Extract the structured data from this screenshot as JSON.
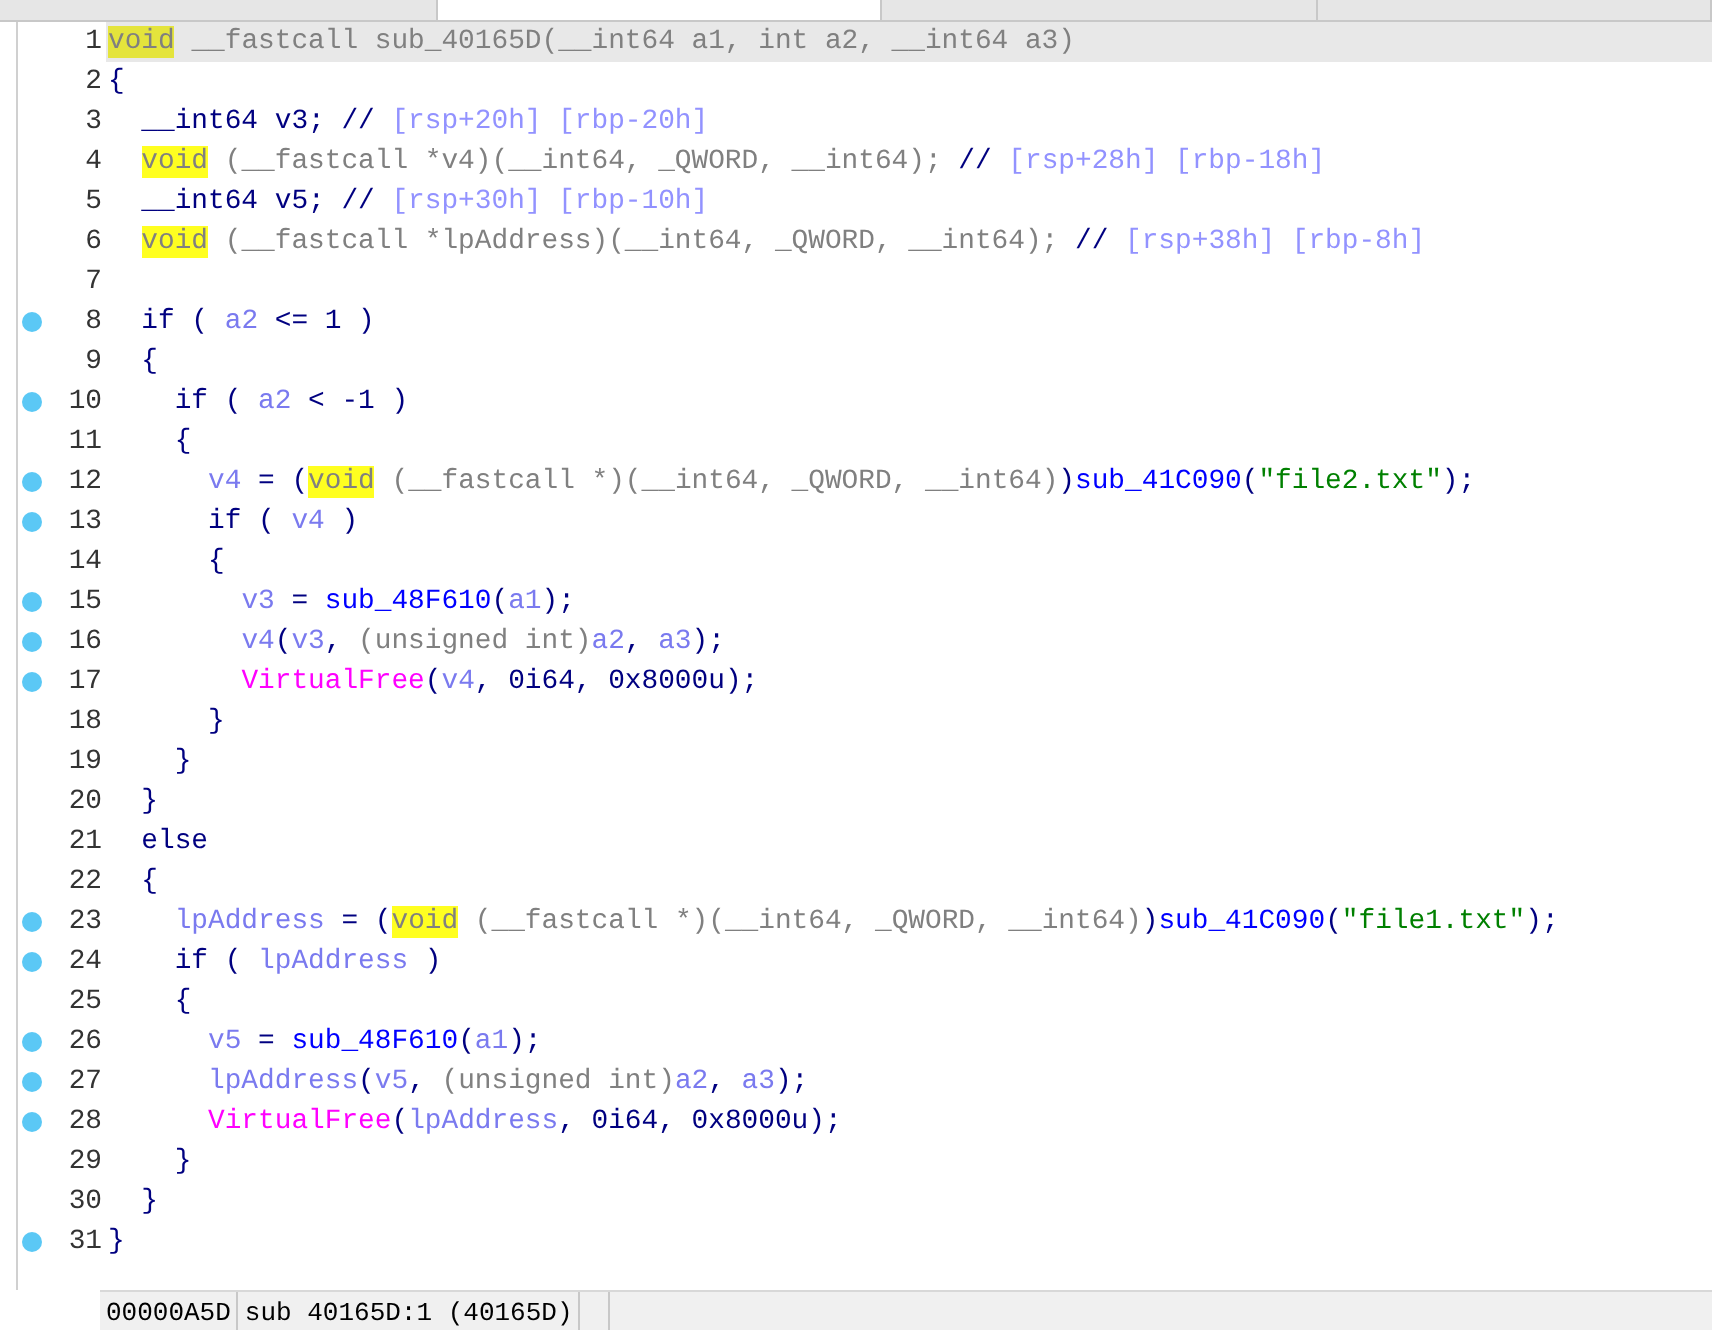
{
  "tabs": [
    {
      "selected": false
    },
    {
      "selected": true
    },
    {
      "selected": false
    },
    {
      "selected": false
    }
  ],
  "code_lines": [
    {
      "number": "1",
      "breakpoint": false,
      "current": true,
      "tokens": [
        {
          "kind": "h",
          "text": "void"
        },
        {
          "kind": "d",
          "text": " __fastcall sub_40165D(__int64 a1, int a2, __int64 a3)"
        }
      ]
    },
    {
      "number": "2",
      "breakpoint": false,
      "current": false,
      "tokens": [
        {
          "kind": "k",
          "text": "{"
        }
      ]
    },
    {
      "number": "3",
      "breakpoint": false,
      "current": false,
      "tokens": [
        {
          "kind": "k",
          "text": "  __int64 v3; // "
        },
        {
          "kind": "c",
          "text": "[rsp+20h] [rbp-20h]"
        }
      ]
    },
    {
      "number": "4",
      "breakpoint": false,
      "current": false,
      "tokens": [
        {
          "kind": "h",
          "text": "  void"
        },
        {
          "kind": "d",
          "text": " (__fastcall *v4)(__int64, _QWORD, __int64);"
        },
        {
          "kind": "k",
          "text": " // "
        },
        {
          "kind": "c",
          "text": "[rsp+28h] [rbp-18h]"
        }
      ]
    },
    {
      "number": "5",
      "breakpoint": false,
      "current": false,
      "tokens": [
        {
          "kind": "k",
          "text": "  __int64 v5; // "
        },
        {
          "kind": "c",
          "text": "[rsp+30h] [rbp-10h]"
        }
      ]
    },
    {
      "number": "6",
      "breakpoint": false,
      "current": false,
      "tokens": [
        {
          "kind": "h",
          "text": "  void"
        },
        {
          "kind": "d",
          "text": " (__fastcall *lpAddress)(__int64, _QWORD, __int64);"
        },
        {
          "kind": "k",
          "text": " // "
        },
        {
          "kind": "c",
          "text": "[rsp+38h] [rbp-8h]"
        }
      ]
    },
    {
      "number": "7",
      "breakpoint": false,
      "current": false
    },
    {
      "number": "8",
      "breakpoint": true,
      "current": false,
      "tokens": [
        {
          "kind": "k",
          "text": "  if ( "
        },
        {
          "kind": "v",
          "text": "a2"
        },
        {
          "kind": "k",
          "text": " <= 1 )"
        }
      ]
    },
    {
      "number": "9",
      "breakpoint": false,
      "current": false,
      "tokens": [
        {
          "kind": "k",
          "text": "  {"
        }
      ]
    },
    {
      "number": "10",
      "breakpoint": true,
      "current": false,
      "tokens": [
        {
          "kind": "k",
          "text": "    if ( "
        },
        {
          "kind": "v",
          "text": "a2"
        },
        {
          "kind": "k",
          "text": " < -1 )"
        }
      ]
    },
    {
      "number": "11",
      "breakpoint": false,
      "current": false,
      "tokens": [
        {
          "kind": "k",
          "text": "    {"
        }
      ]
    },
    {
      "number": "12",
      "breakpoint": true,
      "current": false,
      "tokens": [
        {
          "kind": "v",
          "text": "      v4"
        },
        {
          "kind": "k",
          "text": " = ("
        },
        {
          "kind": "h",
          "text": "void"
        },
        {
          "kind": "d",
          "text": " (__fastcall *)(__int64, _QWORD, __int64)"
        },
        {
          "kind": "k",
          "text": ")"
        },
        {
          "kind": "f",
          "text": "sub_41C090"
        },
        {
          "kind": "k",
          "text": "("
        },
        {
          "kind": "s",
          "text": "\"file2.txt\""
        },
        {
          "kind": "k",
          "text": ");"
        }
      ]
    },
    {
      "number": "13",
      "breakpoint": true,
      "current": false,
      "tokens": [
        {
          "kind": "k",
          "text": "      if ( "
        },
        {
          "kind": "v",
          "text": "v4"
        },
        {
          "kind": "k",
          "text": " )"
        }
      ]
    },
    {
      "number": "14",
      "breakpoint": false,
      "current": false,
      "tokens": [
        {
          "kind": "k",
          "text": "      {"
        }
      ]
    },
    {
      "number": "15",
      "breakpoint": true,
      "current": false,
      "tokens": [
        {
          "kind": "v",
          "text": "        v3"
        },
        {
          "kind": "k",
          "text": " = "
        },
        {
          "kind": "f",
          "text": "sub_48F610"
        },
        {
          "kind": "k",
          "text": "("
        },
        {
          "kind": "v",
          "text": "a1"
        },
        {
          "kind": "k",
          "text": ");"
        }
      ]
    },
    {
      "number": "16",
      "breakpoint": true,
      "current": false,
      "tokens": [
        {
          "kind": "v",
          "text": "        v4"
        },
        {
          "kind": "k",
          "text": "("
        },
        {
          "kind": "v",
          "text": "v3"
        },
        {
          "kind": "k",
          "text": ", "
        },
        {
          "kind": "d",
          "text": "(unsigned int)"
        },
        {
          "kind": "v",
          "text": "a2"
        },
        {
          "kind": "k",
          "text": ", "
        },
        {
          "kind": "v",
          "text": "a3"
        },
        {
          "kind": "k",
          "text": ");"
        }
      ]
    },
    {
      "number": "17",
      "breakpoint": true,
      "current": false,
      "tokens": [
        {
          "kind": "a",
          "text": "        VirtualFree"
        },
        {
          "kind": "k",
          "text": "("
        },
        {
          "kind": "v",
          "text": "v4"
        },
        {
          "kind": "k",
          "text": ", 0i64, 0x8000u);"
        }
      ]
    },
    {
      "number": "18",
      "breakpoint": false,
      "current": false,
      "tokens": [
        {
          "kind": "k",
          "text": "      }"
        }
      ]
    },
    {
      "number": "19",
      "breakpoint": false,
      "current": false,
      "tokens": [
        {
          "kind": "k",
          "text": "    }"
        }
      ]
    },
    {
      "number": "20",
      "breakpoint": false,
      "current": false,
      "tokens": [
        {
          "kind": "k",
          "text": "  }"
        }
      ]
    },
    {
      "number": "21",
      "breakpoint": false,
      "current": false,
      "tokens": [
        {
          "kind": "k",
          "text": "  else"
        }
      ]
    },
    {
      "number": "22",
      "breakpoint": false,
      "current": false,
      "tokens": [
        {
          "kind": "k",
          "text": "  {"
        }
      ]
    },
    {
      "number": "23",
      "breakpoint": true,
      "current": false,
      "tokens": [
        {
          "kind": "v",
          "text": "    lpAddress"
        },
        {
          "kind": "k",
          "text": " = ("
        },
        {
          "kind": "h",
          "text": "void"
        },
        {
          "kind": "d",
          "text": " (__fastcall *)(__int64, _QWORD, __int64)"
        },
        {
          "kind": "k",
          "text": ")"
        },
        {
          "kind": "f",
          "text": "sub_41C090"
        },
        {
          "kind": "k",
          "text": "("
        },
        {
          "kind": "s",
          "text": "\"file1.txt\""
        },
        {
          "kind": "k",
          "text": ");"
        }
      ]
    },
    {
      "number": "24",
      "breakpoint": true,
      "current": false,
      "tokens": [
        {
          "kind": "k",
          "text": "    if ( "
        },
        {
          "kind": "v",
          "text": "lpAddress"
        },
        {
          "kind": "k",
          "text": " )"
        }
      ]
    },
    {
      "number": "25",
      "breakpoint": false,
      "current": false,
      "tokens": [
        {
          "kind": "k",
          "text": "    {"
        }
      ]
    },
    {
      "number": "26",
      "breakpoint": true,
      "current": false,
      "tokens": [
        {
          "kind": "v",
          "text": "      v5"
        },
        {
          "kind": "k",
          "text": " = "
        },
        {
          "kind": "f",
          "text": "sub_48F610"
        },
        {
          "kind": "k",
          "text": "("
        },
        {
          "kind": "v",
          "text": "a1"
        },
        {
          "kind": "k",
          "text": ");"
        }
      ]
    },
    {
      "number": "27",
      "breakpoint": true,
      "current": false,
      "tokens": [
        {
          "kind": "v",
          "text": "      lpAddress"
        },
        {
          "kind": "k",
          "text": "("
        },
        {
          "kind": "v",
          "text": "v5"
        },
        {
          "kind": "k",
          "text": ", "
        },
        {
          "kind": "d",
          "text": "(unsigned int)"
        },
        {
          "kind": "v",
          "text": "a2"
        },
        {
          "kind": "k",
          "text": ", "
        },
        {
          "kind": "v",
          "text": "a3"
        },
        {
          "kind": "k",
          "text": ");"
        }
      ]
    },
    {
      "number": "28",
      "breakpoint": true,
      "current": false,
      "tokens": [
        {
          "kind": "a",
          "text": "      VirtualFree"
        },
        {
          "kind": "k",
          "text": "("
        },
        {
          "kind": "v",
          "text": "lpAddress"
        },
        {
          "kind": "k",
          "text": ", 0i64, 0x8000u);"
        }
      ]
    },
    {
      "number": "29",
      "breakpoint": false,
      "current": false,
      "tokens": [
        {
          "kind": "k",
          "text": "    }"
        }
      ]
    },
    {
      "number": "30",
      "breakpoint": false,
      "current": false,
      "tokens": [
        {
          "kind": "k",
          "text": "  }"
        }
      ]
    },
    {
      "number": "31",
      "breakpoint": true,
      "current": false,
      "tokens": [
        {
          "kind": "k",
          "text": "}"
        }
      ]
    }
  ],
  "status_bar": {
    "address": "00000A5D",
    "location": "sub 40165D:1 (40165D)"
  }
}
